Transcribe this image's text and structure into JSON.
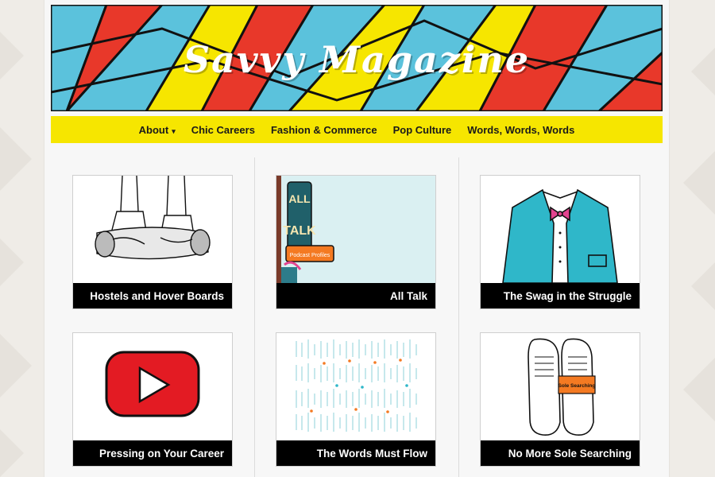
{
  "site": {
    "title": "Savvy Magazine"
  },
  "nav": {
    "items": [
      {
        "label": "About",
        "has_dropdown": true
      },
      {
        "label": "Chic Careers"
      },
      {
        "label": "Fashion & Commerce"
      },
      {
        "label": "Pop Culture"
      },
      {
        "label": "Words, Words, Words"
      }
    ]
  },
  "articles": [
    {
      "title": "Hostels and Hover Boards"
    },
    {
      "title": "All Talk",
      "sign_top": "ALL",
      "sign_bottom": "TALK",
      "sign_tag": "Podcast Profiles"
    },
    {
      "title": "The Swag in the Struggle"
    },
    {
      "title": "Pressing on Your Career"
    },
    {
      "title": "The Words Must Flow"
    },
    {
      "title": "No More Sole Searching",
      "tag": "Sole Searching"
    }
  ],
  "colors": {
    "red": "#e8382a",
    "blue": "#5bc2dc",
    "yellow": "#f6e600",
    "teal": "#2fb7c9",
    "pink": "#e3448f",
    "orange": "#f47a22"
  }
}
